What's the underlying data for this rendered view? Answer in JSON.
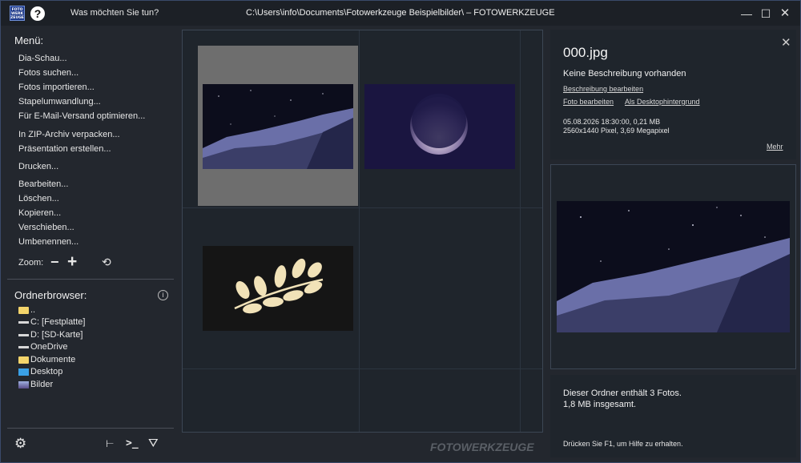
{
  "titlebar": {
    "logo_text": "FOTO-WERK-ZEUGE",
    "help_glyph": "?",
    "what_todo": "Was möchten Sie tun?",
    "title": "C:\\Users\\info\\Documents\\Fotowerkzeuge Beispielbilder\\ – FOTOWERKZEUGE",
    "minimize": "—",
    "maximize": "☐",
    "close": "✕"
  },
  "sidebar": {
    "menu_heading": "Menü:",
    "menu_items": [
      "Dia-Schau...",
      "Fotos suchen...",
      "Fotos importieren...",
      "Stapelumwandlung...",
      "Für E-Mail-Versand optimieren...",
      "In ZIP-Archiv verpacken...",
      "Präsentation erstellen...",
      "Drucken...",
      "Bearbeiten...",
      "Löschen...",
      "Kopieren...",
      "Verschieben...",
      "Umbenennen..."
    ],
    "zoom": {
      "label": "Zoom:",
      "minus": "−",
      "plus": "+",
      "rotate": "⟲"
    },
    "folder_heading": "Ordnerbrowser:",
    "info_glyph": "i",
    "folders": [
      {
        "label": "..",
        "icon": "folder-icon"
      },
      {
        "label": "C: [Festplatte]",
        "icon": "drive-icon"
      },
      {
        "label": "D: [SD-Karte]",
        "icon": "drive-icon"
      },
      {
        "label": "OneDrive",
        "icon": "drive-icon"
      },
      {
        "label": "Dokumente",
        "icon": "folder-icon"
      },
      {
        "label": "Desktop",
        "icon": "desktop-icon"
      },
      {
        "label": "Bilder",
        "icon": "pictures-icon"
      }
    ],
    "bottom": {
      "gear": "⚙",
      "tree": "⊢",
      "terminal": ">_",
      "filter": "⛛"
    }
  },
  "grid": {
    "watermark": "FOTOWERKZEUGE",
    "photos": [
      "mountain",
      "moon",
      "leaf"
    ],
    "selected_index": 0
  },
  "details": {
    "close": "✕",
    "file_name": "000.jpg",
    "description": "Keine Beschreibung vorhanden",
    "edit_description": "Beschreibung bearbeiten",
    "edit_photo": "Foto bearbeiten",
    "set_wallpaper": "Als Desktophintergrund",
    "date_size": "05.08.2026 18:30:00, 0,21 MB",
    "dimensions": "2560x1440 Pixel, 3,69 Megapixel",
    "more": "Mehr"
  },
  "status": {
    "line1": "Dieser Ordner enthält 3 Fotos.",
    "line2": "1,8 MB insgesamt.",
    "hint": "Drücken Sie F1, um Hilfe zu erhalten."
  },
  "colors": {
    "background": "#23272e",
    "panel": "#1f252c",
    "selection": "#6e6e6e",
    "accent_folder": "#f3d46b",
    "accent_desktop": "#3aa0e6"
  }
}
